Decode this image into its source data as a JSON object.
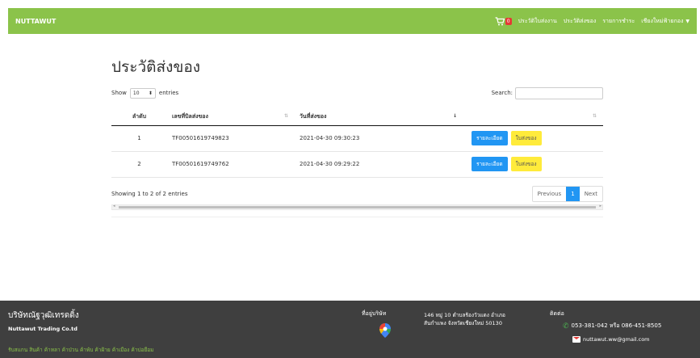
{
  "navbar": {
    "brand": "NUTTAWUT",
    "cart_count": "0",
    "links": [
      "ประวัติใบส่งงาน",
      "ประวัติส่งของ",
      "รายการชำระ",
      "เชียงใหม่ฟ้ายกอง"
    ]
  },
  "page": {
    "title": "ประวัติส่งของ",
    "show_label": "Show",
    "show_value": "10",
    "entries_label": "entries",
    "search_label": "Search:"
  },
  "table": {
    "headers": [
      "ลำดับ",
      "เลขที่บิลส่งของ",
      "วันที่ส่งของ",
      ""
    ],
    "rows": [
      {
        "no": "1",
        "bill": "TF00501619749823",
        "date": "2021-04-30 09:30:23",
        "detail": "รายละเอียด",
        "receipt": "ใบส่งของ"
      },
      {
        "no": "2",
        "bill": "TF00501619749762",
        "date": "2021-04-30 09:29:22",
        "detail": "รายละเอียด",
        "receipt": "ใบส่งของ"
      }
    ]
  },
  "pagination": {
    "info": "Showing 1 to 2 of 2 entries",
    "previous": "Previous",
    "current": "1",
    "next": "Next"
  },
  "footer": {
    "company_th": "บริษัทณัฐวุฒิเทรดดิ้ง",
    "company_en": "Nuttawut Trading Co.td",
    "services": "รับสแกน สินค้า ค้าหลา ค้าป่วน ค้าพับ ค้าฝ้าย ค้าเมือง ค้าปอยือม",
    "location_label": "ที่อยู่บริษัท",
    "address_line1": "146 หมู่ 10 ตำบลร้องวัวแดง อำเภอ",
    "address_line2": "สันกำแพง จังหวัดเชียงใหม่ 50130",
    "contact_label": "ติดต่อ",
    "phone": "053-381-042 หรือ 086-451-8505",
    "email": "nuttawut.ww@gmail.com"
  }
}
